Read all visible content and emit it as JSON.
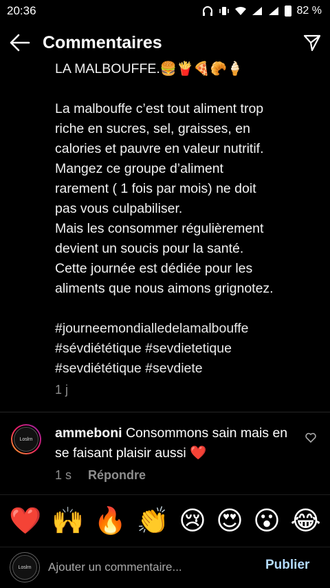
{
  "status_bar": {
    "time": "20:36",
    "battery_percent": "82 %"
  },
  "header": {
    "title": "Commentaires"
  },
  "caption": {
    "line_title": "LA MALBOUFFE.🍔🍟🍕🥐🍦",
    "paragraph": "La malbouffe c’est tout aliment trop\nriche en sucres, sel, graisses, en\ncalories et pauvre en valeur nutritif.\nMangez ce groupe d’aliment\nrarement ( 1 fois par mois) ne doit\npas vous culpabiliser.\nMais les consommer régulièrement\ndevient un soucis pour la santé.\nCette journée est dédiée pour les\naliments que nous aimons grignotez.",
    "hashtags": "#journeemondialledelamalbouffe\n#sévdiététique #sevdietetique\n#sevdiététique #sevdiete",
    "time": "1 j"
  },
  "comment": {
    "username": "ammeboni",
    "text": " Consommons sain mais en se faisant plaisir aussi ❤️",
    "time": "1 s",
    "reply_label": "Répondre",
    "avatar_text": "Loslrn"
  },
  "reactions": [
    "❤️",
    "🙌",
    "🔥",
    "👏",
    "😢",
    "😍",
    "😮",
    "😂"
  ],
  "composer": {
    "placeholder": "Ajouter un commentaire...",
    "publish_label": "Publier",
    "avatar_text": "Loslrn"
  },
  "colors": {
    "background": "#000000",
    "muted": "#8e8e8e",
    "publish": "#b3dbff"
  }
}
